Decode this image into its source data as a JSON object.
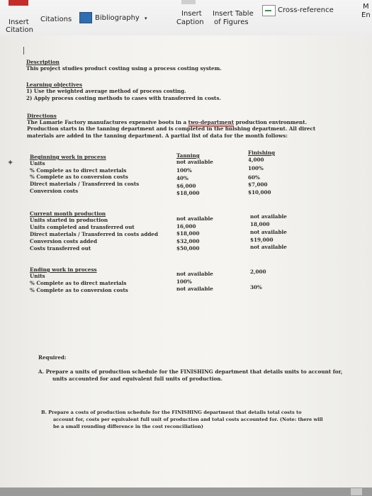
{
  "ribbon": {
    "insert_citation_line1": "Insert",
    "insert_citation_line2": "Citation",
    "citations": "Citations",
    "bibliography": "Bibliography",
    "insert_caption_line1": "Insert",
    "insert_caption_line2": "Caption",
    "insert_table_figures_line1": "Insert Table",
    "insert_table_figures_line2": "of Figures",
    "cross_reference": "Cross-reference",
    "right_edge_top": "M",
    "right_edge_bottom": "En"
  },
  "doc": {
    "description_heading": "Description",
    "description_text": "This project studies product costing using a process costing system.",
    "objectives_heading": "Learning objectives",
    "objective_1": "1)   Use the weighted average method of process costing.",
    "objective_2": "2)   Apply process costing methods to cases with transferred in costs.",
    "directions_heading": "Directions",
    "directions_line1_a": "The Lamarie Factory manufactures expensive boots in a ",
    "directions_line1_b": "two-department",
    "directions_line1_c": " production environment.",
    "directions_line2": "Production starts in the tanning department and is completed in the finishing department.  All direct",
    "directions_line3": "materials are added in the tanning department.  A partial list of data for the month follows:",
    "col_tanning": "Tanning",
    "col_finishing": "Finishing",
    "bwip_heading": "Beginning work in process",
    "bwip_rows": [
      {
        "label": "Units",
        "tanning": "not available",
        "finishing": "4,000"
      },
      {
        "label": "% Complete as to direct materials",
        "tanning": "100%",
        "finishing": "100%"
      },
      {
        "label": "% Complete as to conversion costs",
        "tanning": "40%",
        "finishing": "60%"
      },
      {
        "label": "Direct materials / Transferred in costs",
        "tanning": "$6,000",
        "finishing": "$7,000"
      },
      {
        "label": "Conversion costs",
        "tanning": "$18,000",
        "finishing": "$10,000"
      }
    ],
    "cmp_heading": "Current month production",
    "cmp_rows": [
      {
        "label": "Units started in production",
        "tanning": "not available",
        "finishing": "not available"
      },
      {
        "label": "Units completed and transferred out",
        "tanning": "16,000",
        "finishing": "18,000"
      },
      {
        "label": "Direct materials / Transferred in costs added",
        "tanning": "$18,000",
        "finishing": "not available"
      },
      {
        "label": "Conversion costs added",
        "tanning": "$32,000",
        "finishing": "$19,000"
      },
      {
        "label": "Costs transferred out",
        "tanning": "$50,000",
        "finishing": "not available"
      }
    ],
    "ewip_heading": "Ending work in process",
    "ewip_rows": [
      {
        "label": "Units",
        "tanning": "not available",
        "finishing": "2,000"
      },
      {
        "label": "% Complete as to direct materials",
        "tanning": "100%",
        "finishing": ""
      },
      {
        "label": "% Complete as to conversion costs",
        "tanning": "not available",
        "finishing": "30%"
      }
    ],
    "required_heading": "Required:",
    "req_a_line1": "A.   Prepare a units of production schedule for the FINISHING department that details units to account for,",
    "req_a_line2": "units accounted for and equivalent full units of production.",
    "req_b_line1": "B.   Prepare a costs of production schedule for the FINISHING department that details total costs to",
    "req_b_line2": "account for, costs per equivalent full unit of production and total costs accounted for.  (Note:  there will",
    "req_b_line3": "be a small rounding difference in the cost reconciliation)"
  }
}
